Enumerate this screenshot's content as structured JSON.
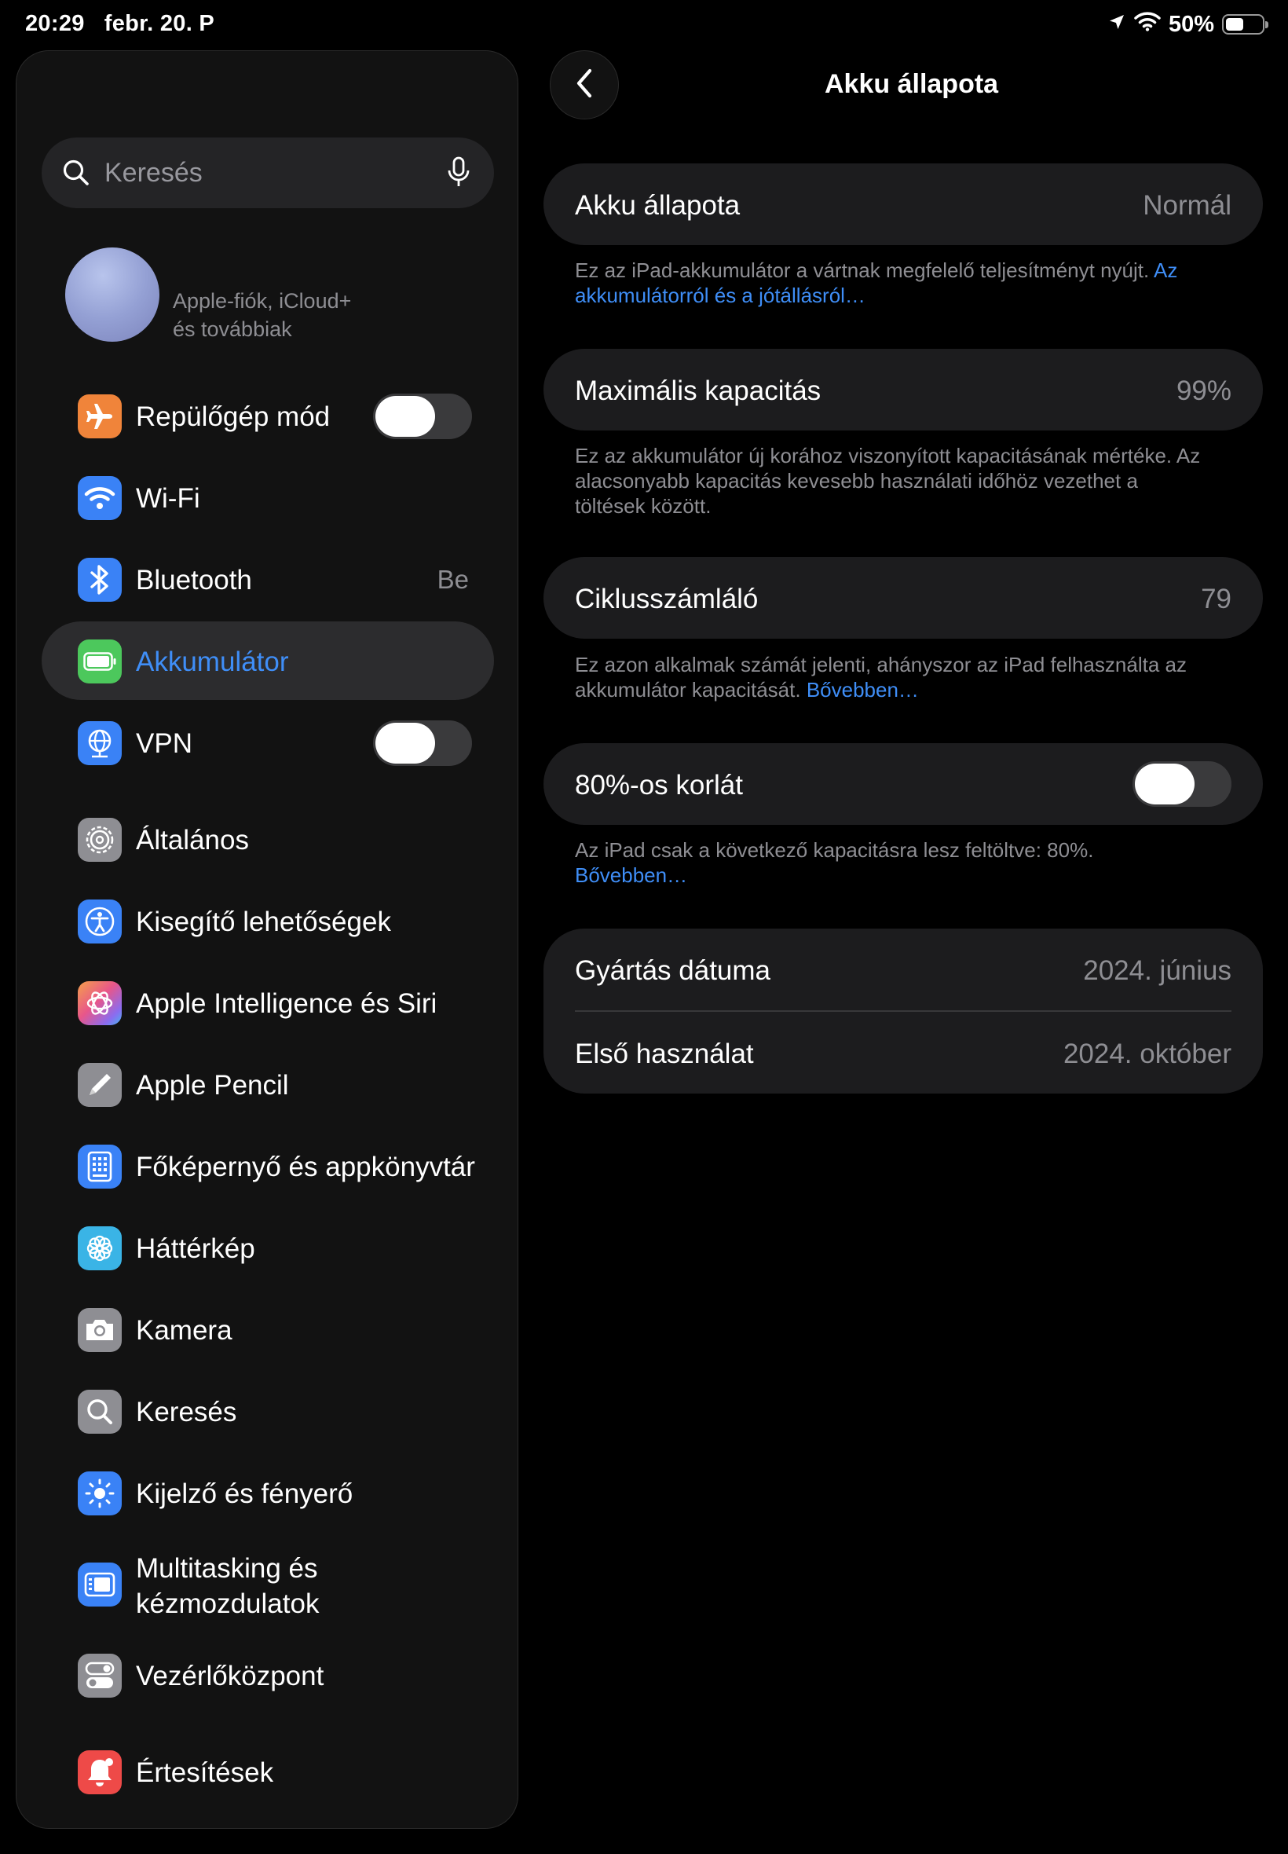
{
  "status_bar": {
    "time": "20:29",
    "date": "febr. 20. P",
    "battery_text": "50%",
    "battery_level": 0.5
  },
  "sidebar": {
    "search_placeholder": "Keresés",
    "account_subtitle_line1": "Apple-fiók, iCloud+",
    "account_subtitle_line2": "és továbbiak",
    "items": [
      {
        "label": "Repülőgép mód",
        "icon": "airplane-icon",
        "color": "#f0843a",
        "toggle": false
      },
      {
        "label": "Wi-Fi",
        "icon": "wifi-icon",
        "color": "#3a82f6"
      },
      {
        "label": "Bluetooth",
        "icon": "bluetooth-icon",
        "color": "#3a82f6",
        "value": "Be"
      },
      {
        "label": "Akkumulátor",
        "icon": "battery-icon",
        "color": "#4cc85c",
        "selected": true
      },
      {
        "label": "VPN",
        "icon": "globe-icon",
        "color": "#3a82f6",
        "toggle": false
      },
      {
        "label": "Általános",
        "icon": "gear-icon",
        "color": "#8e8e93"
      },
      {
        "label": "Kisegítő lehetőségek",
        "icon": "accessibility-icon",
        "color": "#3a82f6"
      },
      {
        "label": "Apple Intelligence és Siri",
        "icon": "siri-icon",
        "color": "#d062a8"
      },
      {
        "label": "Apple Pencil",
        "icon": "pencil-icon",
        "color": "#8e8e93"
      },
      {
        "label": "Főképernyő és appkönyvtár",
        "icon": "home-screen-icon",
        "color": "#3a82f6"
      },
      {
        "label": "Háttérkép",
        "icon": "flower-icon",
        "color": "#3ab4e6"
      },
      {
        "label": "Kamera",
        "icon": "camera-icon",
        "color": "#8e8e93"
      },
      {
        "label": "Keresés",
        "icon": "search-icon",
        "color": "#8e8e93"
      },
      {
        "label": "Kijelző és fényerő",
        "icon": "sun-icon",
        "color": "#3a82f6"
      },
      {
        "label_line1": "Multitasking és",
        "label_line2": "kézmozdulatok",
        "icon": "multitasking-icon",
        "color": "#3a82f6"
      },
      {
        "label": "Vezérlőközpont",
        "icon": "switches-icon",
        "color": "#8e8e93"
      },
      {
        "label": "Értesítések",
        "icon": "bell-icon",
        "color": "#ee4a48"
      }
    ]
  },
  "detail": {
    "title": "Akku állapota",
    "health": {
      "label": "Akku állapota",
      "value": "Normál"
    },
    "health_note": "Ez az iPad-akkumulátor a vártnak megfelelő teljesítményt nyújt.",
    "health_link_part1": "Az",
    "health_link_part2": "akkumulátorról és a jótállásról…",
    "capacity": {
      "label": "Maximális kapacitás",
      "value": "99%"
    },
    "capacity_note_line1": "Ez az akkumulátor új korához viszonyított kapacitásának mértéke. Az",
    "capacity_note_line2": "alacsonyabb kapacitás kevesebb használati időhöz vezethet a",
    "capacity_note_line3": "töltések között.",
    "cycles": {
      "label": "Ciklusszámláló",
      "value": "79"
    },
    "cycles_note_line1": "Ez azon alkalmak számát jelenti, ahányszor az iPad felhasználta az",
    "cycles_note_line2": "akkumulátor kapacitását.",
    "cycles_link": "Bővebben…",
    "limit": {
      "label": "80%-os korlát",
      "on": false
    },
    "limit_note": "Az iPad csak a következő kapacitásra lesz feltöltve: 80%.",
    "limit_link": "Bővebben…",
    "manufacture": {
      "label": "Gyártás dátuma",
      "value": "2024. június"
    },
    "first_use": {
      "label": "Első használat",
      "value": "2024. október"
    }
  }
}
